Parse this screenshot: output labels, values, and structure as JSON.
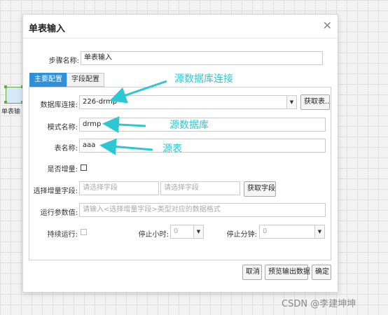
{
  "canvas": {
    "node_label": "单表输"
  },
  "dialog": {
    "title": "单表输入",
    "close_glyph": "✕",
    "step_name": {
      "label": "步骤名称:",
      "value": "单表输入"
    },
    "tabs": [
      {
        "label": "主要配置",
        "active": true
      },
      {
        "label": "字段配置",
        "active": false
      }
    ],
    "db_connection": {
      "label": "数据库连接:",
      "value": "226-drmp",
      "fetch_button": "获取表.."
    },
    "schema_name": {
      "label": "模式名称:",
      "value": "drmp"
    },
    "table_name": {
      "label": "表名称:",
      "value": "aaa"
    },
    "incremental": {
      "label": "是否增量:",
      "checked": false
    },
    "incremental_field": {
      "label": "选择增量字段:",
      "placeholder_1": "请选择字段",
      "placeholder_2": "请选择字段",
      "fetch_button": "获取字段"
    },
    "run_param": {
      "label": "运行参数值:",
      "placeholder": "请输入<选择增量字段>类型对应的数据格式"
    },
    "continuous": {
      "label": "持续运行:",
      "stop_hour_label": "停止小时:",
      "stop_hour_value": "0",
      "stop_minute_label": "停止分钟:",
      "stop_minute_value": "0"
    },
    "footer": {
      "cancel": "取消",
      "preview": "预览输出数据",
      "confirm": "确定"
    }
  },
  "annotations": {
    "db_source": "源数据库连接",
    "schema": "源数据库",
    "table": "源表",
    "color": "#2cc7d3"
  },
  "watermark": "CSDN @李建坤坤"
}
